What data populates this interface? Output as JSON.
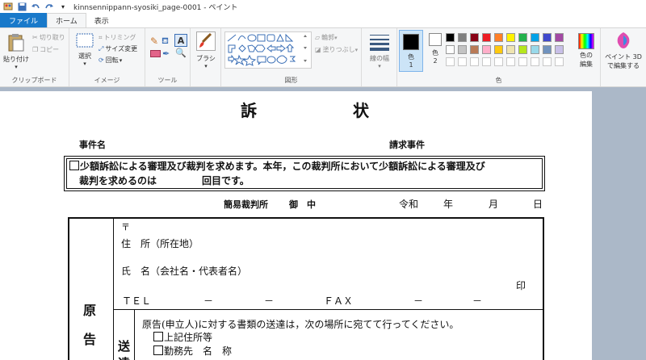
{
  "window": {
    "title": "kinnsennippann-syosiki_page-0001 - ペイント",
    "quick_access": [
      "paint-app-icon",
      "save-icon",
      "undo-icon",
      "redo-icon",
      "customize-icon"
    ]
  },
  "tabs": [
    {
      "label": "ファイル"
    },
    {
      "label": "ホーム"
    },
    {
      "label": "表示"
    }
  ],
  "ribbon": {
    "clipboard": {
      "label": "クリップボード",
      "paste": "貼り付け",
      "cut": "切り取り",
      "copy": "コピー"
    },
    "image": {
      "label": "イメージ",
      "select": "選択",
      "crop": "トリミング",
      "resize": "サイズ変更",
      "rotate": "回転"
    },
    "tools": {
      "label": "ツール"
    },
    "brush": {
      "label": "ブラシ"
    },
    "shapes": {
      "label": "図形",
      "outline": "輪郭",
      "fill": "塗りつぶし"
    },
    "size": {
      "label": "線の幅"
    },
    "colors": {
      "label": "色",
      "color1": "色\n1",
      "color1_a": "色",
      "color1_b": "1",
      "color2_a": "色",
      "color2_b": "2",
      "edit_a": "色の",
      "edit_b": "編集",
      "color1_value": "#000000",
      "color2_value": "#ffffff",
      "palette_row1": [
        "#000000",
        "#7f7f7f",
        "#880015",
        "#ed1c24",
        "#ff7f27",
        "#fff200",
        "#22b14c",
        "#00a2e8",
        "#3f48cc",
        "#a349a4"
      ],
      "palette_row2": [
        "#ffffff",
        "#c3c3c3",
        "#b97a57",
        "#ffaec9",
        "#ffc90e",
        "#efe4b0",
        "#b5e61d",
        "#99d9ea",
        "#7092be",
        "#c8bfe7"
      ]
    },
    "paint3d": {
      "a": "ペイント 3D",
      "b": "で編集する"
    }
  },
  "document": {
    "title1": "訴",
    "title2": "状",
    "case_name": "事件名",
    "claim_case": "請求事件",
    "small_claims_line1": "少額訴訟による審理及び裁判を求めます。本年，この裁判所において少額訴訟による審理及び",
    "small_claims_line2a": "裁判を求めるのは",
    "small_claims_line2b": "回目です。",
    "court": "簡易裁判所",
    "to": "御　中",
    "era": "令和",
    "year": "年",
    "month": "月",
    "day": "日",
    "postal": "〒",
    "address": "住　所（所在地）",
    "name": "氏　名（会社名・代表者名）",
    "seal": "印",
    "tel": "ＴＥＬ",
    "fax": "ＦＡＸ",
    "dash": "－",
    "plaintiff_a": "原",
    "plaintiff_b": "告",
    "service_a": "送",
    "service_b": "達",
    "service_text": "原告(申立人)に対する書類の送達は，次の場所に宛てて行ってください。",
    "option1": "上記住所等",
    "option2": "勤務先　名　称",
    "postal2": "〒"
  }
}
